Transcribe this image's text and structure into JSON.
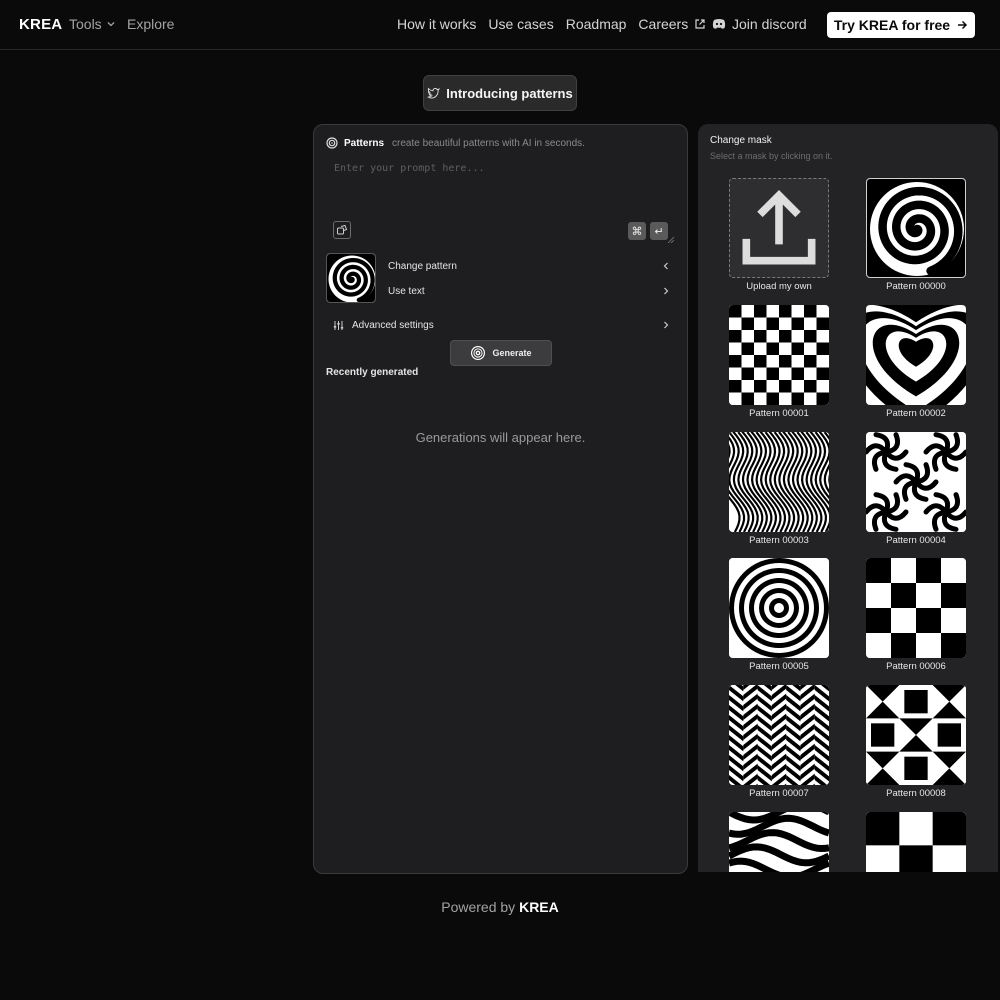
{
  "nav": {
    "brand": "KREA",
    "tools": "Tools",
    "explore": "Explore",
    "links": [
      "How it works",
      "Use cases",
      "Roadmap",
      "Careers"
    ],
    "discord": "Join discord",
    "cta": "Try KREA for free"
  },
  "intro": {
    "label": "Introducing patterns"
  },
  "generator": {
    "title": "Patterns",
    "subtitle": "create beautiful patterns with AI in seconds.",
    "prompt_placeholder": "Enter your prompt here...",
    "prompt_value": "",
    "change_pattern": "Change pattern",
    "use_text": "Use text",
    "advanced": "Advanced settings",
    "generate": "Generate",
    "recent_heading": "Recently generated",
    "empty_message": "Generations will appear here."
  },
  "mask": {
    "title": "Change mask",
    "subtitle": "Select a mask by clicking on it.",
    "upload_label": "Upload my own",
    "patterns": [
      {
        "label": "Pattern 00000",
        "kind": "spiral"
      },
      {
        "label": "Pattern 00001",
        "kind": "checker-fine"
      },
      {
        "label": "Pattern 00002",
        "kind": "hearts"
      },
      {
        "label": "Pattern 00003",
        "kind": "waves"
      },
      {
        "label": "Pattern 00004",
        "kind": "swirls"
      },
      {
        "label": "Pattern 00005",
        "kind": "rings"
      },
      {
        "label": "Pattern 00006",
        "kind": "checker-coarse"
      },
      {
        "label": "Pattern 00007",
        "kind": "chevron"
      },
      {
        "label": "Pattern 00008",
        "kind": "geometric"
      },
      {
        "label": "",
        "kind": "blobs"
      },
      {
        "label": "",
        "kind": "checker-large"
      }
    ]
  },
  "footer": {
    "prefix": "Powered by",
    "brand": "KREA"
  },
  "colors": {
    "background": "#0a0a0a",
    "panel": "#1e1e20",
    "accent": "#ffffff"
  }
}
